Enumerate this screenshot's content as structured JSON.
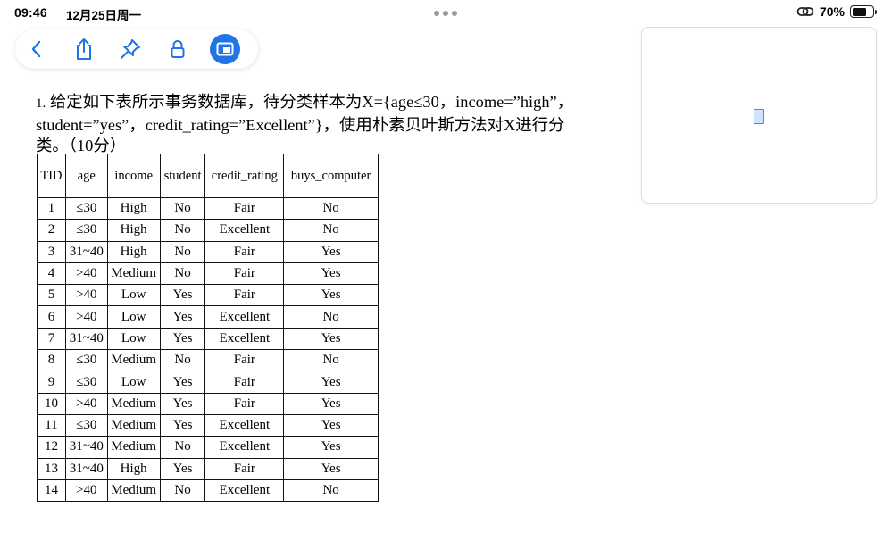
{
  "status_bar": {
    "time": "09:46",
    "date": "12月25日周一",
    "battery_percent_label": "70%",
    "battery_level": 0.7
  },
  "toolbar": {
    "buttons": [
      {
        "name": "back",
        "icon": "chevron-left-icon"
      },
      {
        "name": "share",
        "icon": "share-icon"
      },
      {
        "name": "pin",
        "icon": "pin-icon"
      },
      {
        "name": "lock",
        "icon": "lock-icon"
      },
      {
        "name": "window",
        "icon": "window-icon",
        "active": true
      }
    ],
    "accent_color": "#1f74e8"
  },
  "document": {
    "question_number": "1.",
    "question_line1": "给定如下表所示事务数据库，待分类样本为X={age≤30，income=”high”，",
    "question_line2": "student=”yes”，credit_rating=”Excellent”}，使用朴素贝叶斯方法对X进行分",
    "question_line3": "类。（10分）",
    "table": {
      "headers": [
        "TID",
        "age",
        "income",
        "student",
        "credit_rating",
        "buys_computer"
      ],
      "rows": [
        [
          "1",
          "≤30",
          "High",
          "No",
          "Fair",
          "No"
        ],
        [
          "2",
          "≤30",
          "High",
          "No",
          "Excellent",
          "No"
        ],
        [
          "3",
          "31~40",
          "High",
          "No",
          "Fair",
          "Yes"
        ],
        [
          "4",
          ">40",
          "Medium",
          "No",
          "Fair",
          "Yes"
        ],
        [
          "5",
          ">40",
          "Low",
          "Yes",
          "Fair",
          "Yes"
        ],
        [
          "6",
          ">40",
          "Low",
          "Yes",
          "Excellent",
          "No"
        ],
        [
          "7",
          "31~40",
          "Low",
          "Yes",
          "Excellent",
          "Yes"
        ],
        [
          "8",
          "≤30",
          "Medium",
          "No",
          "Fair",
          "No"
        ],
        [
          "9",
          "≤30",
          "Low",
          "Yes",
          "Fair",
          "Yes"
        ],
        [
          "10",
          ">40",
          "Medium",
          "Yes",
          "Fair",
          "Yes"
        ],
        [
          "11",
          "≤30",
          "Medium",
          "Yes",
          "Excellent",
          "Yes"
        ],
        [
          "12",
          "31~40",
          "Medium",
          "No",
          "Excellent",
          "Yes"
        ],
        [
          "13",
          "31~40",
          "High",
          "Yes",
          "Fair",
          "Yes"
        ],
        [
          "14",
          ">40",
          "Medium",
          "No",
          "Excellent",
          "No"
        ]
      ]
    }
  },
  "thumbnail_panel": {
    "page_icon": "page-thumbnail-icon"
  }
}
